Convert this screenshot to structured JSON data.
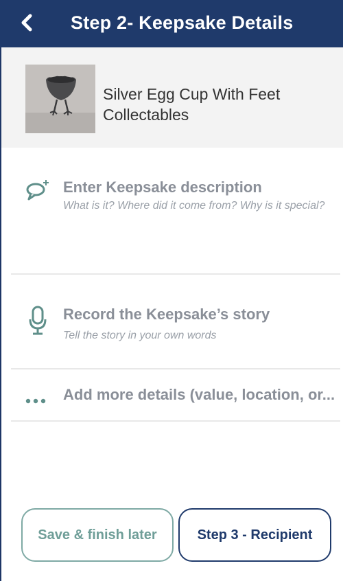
{
  "header": {
    "title": "Step 2- Keepsake Details",
    "back_icon": "chevron-left-icon"
  },
  "item": {
    "name": "Silver Egg Cup With Feet Collectables",
    "thumbnail_icon": "egg-cup-photo"
  },
  "rows": [
    {
      "title": "Enter Keepsake description",
      "subtitle": "What is it? Where did it come from? Why is it special?",
      "icon": "speech-bubble-plus-icon"
    },
    {
      "title": "Record the Keepsake’s story",
      "subtitle": "Tell the story in your own words",
      "icon": "microphone-icon"
    },
    {
      "title": "Add more details (value, location, or...",
      "icon": "more-dots-icon"
    }
  ],
  "buttons": {
    "later": "Save & finish later",
    "next": "Step 3 - Recipient"
  },
  "colors": {
    "header_bg": "#1f3a6b",
    "accent_teal": "#5f8f8a",
    "muted_text": "#8a8f98"
  }
}
